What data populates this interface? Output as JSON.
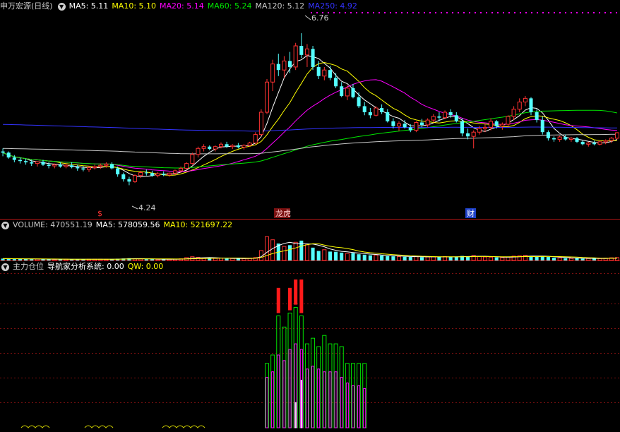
{
  "stock": {
    "name": "申万宏源",
    "period": "(日线)"
  },
  "colors": {
    "bg": "#000000",
    "up": "#ff3232",
    "down": "#54ffff",
    "ma5": "#ffffff",
    "ma10": "#ffff00",
    "ma20": "#ff00ff",
    "ma60": "#00e600",
    "ma120": "#c8c8c8",
    "ma250": "#3333ff",
    "axis": "#b01515",
    "panel": "#ff3c3c"
  },
  "price_legend": [
    {
      "label": "MA5: 5.11",
      "color": "#ffffff"
    },
    {
      "label": "MA10: 5.10",
      "color": "#ffff00"
    },
    {
      "label": "MA20: 5.14",
      "color": "#ff00ff"
    },
    {
      "label": "MA60: 5.24",
      "color": "#00e600"
    },
    {
      "label": "MA120: 5.12",
      "color": "#c8c8c8"
    },
    {
      "label": "MA250: 4.92",
      "color": "#3333ff"
    }
  ],
  "volume_legend": {
    "title": "VOLUME: 470551.19",
    "items": [
      {
        "label": "MA5: 578059.56",
        "color": "#ffffff"
      },
      {
        "label": "MA10: 521697.22",
        "color": "#ffff00"
      }
    ]
  },
  "indicator_legend": {
    "title": "主力仓位",
    "items": [
      {
        "label": "导航家分析系统: 0.00",
        "color": "#ffffff"
      },
      {
        "label": "QW: 0.00",
        "color": "#ffff00"
      }
    ]
  },
  "markers": {
    "high": "6.76",
    "low": "4.24",
    "event1": "$",
    "event2": "龙虎",
    "event3": "财"
  },
  "chart_data": {
    "type": "candlestick",
    "ylim": [
      3.8,
      7.1
    ],
    "ohlc": [
      [
        4.8,
        4.85,
        4.72,
        4.78
      ],
      [
        4.78,
        4.8,
        4.68,
        4.7
      ],
      [
        4.7,
        4.74,
        4.62,
        4.66
      ],
      [
        4.66,
        4.7,
        4.6,
        4.64
      ],
      [
        4.64,
        4.68,
        4.58,
        4.62
      ],
      [
        4.62,
        4.66,
        4.56,
        4.6
      ],
      [
        4.6,
        4.64,
        4.55,
        4.63
      ],
      [
        4.63,
        4.66,
        4.56,
        4.58
      ],
      [
        4.58,
        4.62,
        4.52,
        4.56
      ],
      [
        4.56,
        4.6,
        4.52,
        4.58
      ],
      [
        4.58,
        4.62,
        4.53,
        4.55
      ],
      [
        4.55,
        4.6,
        4.52,
        4.57
      ],
      [
        4.57,
        4.62,
        4.52,
        4.54
      ],
      [
        4.54,
        4.58,
        4.48,
        4.52
      ],
      [
        4.52,
        4.56,
        4.47,
        4.5
      ],
      [
        4.5,
        4.56,
        4.46,
        4.53
      ],
      [
        4.53,
        4.58,
        4.5,
        4.55
      ],
      [
        4.55,
        4.6,
        4.51,
        4.57
      ],
      [
        4.57,
        4.62,
        4.53,
        4.59
      ],
      [
        4.59,
        4.62,
        4.5,
        4.52
      ],
      [
        4.52,
        4.55,
        4.38,
        4.42
      ],
      [
        4.42,
        4.45,
        4.3,
        4.34
      ],
      [
        4.34,
        4.38,
        4.24,
        4.3
      ],
      [
        4.3,
        4.42,
        4.28,
        4.4
      ],
      [
        4.4,
        4.48,
        4.36,
        4.45
      ],
      [
        4.45,
        4.5,
        4.4,
        4.44
      ],
      [
        4.44,
        4.48,
        4.38,
        4.4
      ],
      [
        4.4,
        4.46,
        4.37,
        4.43
      ],
      [
        4.43,
        4.47,
        4.39,
        4.41
      ],
      [
        4.41,
        4.45,
        4.38,
        4.44
      ],
      [
        4.44,
        4.5,
        4.41,
        4.48
      ],
      [
        4.48,
        4.55,
        4.45,
        4.52
      ],
      [
        4.52,
        4.62,
        4.5,
        4.6
      ],
      [
        4.6,
        4.78,
        4.58,
        4.75
      ],
      [
        4.75,
        4.88,
        4.7,
        4.85
      ],
      [
        4.85,
        4.92,
        4.8,
        4.88
      ],
      [
        4.88,
        4.9,
        4.82,
        4.84
      ],
      [
        4.84,
        4.9,
        4.8,
        4.88
      ],
      [
        4.88,
        4.95,
        4.85,
        4.92
      ],
      [
        4.92,
        4.96,
        4.86,
        4.88
      ],
      [
        4.88,
        4.92,
        4.84,
        4.9
      ],
      [
        4.9,
        4.94,
        4.85,
        4.87
      ],
      [
        4.87,
        4.92,
        4.83,
        4.9
      ],
      [
        4.9,
        4.96,
        4.88,
        4.94
      ],
      [
        4.94,
        5.12,
        4.92,
        5.08
      ],
      [
        5.08,
        5.5,
        5.05,
        5.45
      ],
      [
        5.45,
        6.0,
        5.42,
        5.95
      ],
      [
        5.95,
        6.32,
        5.8,
        6.25
      ],
      [
        6.25,
        6.42,
        6.05,
        6.15
      ],
      [
        6.15,
        6.38,
        6.02,
        6.3
      ],
      [
        6.3,
        6.45,
        6.1,
        6.2
      ],
      [
        6.2,
        6.6,
        6.15,
        6.55
      ],
      [
        6.55,
        6.76,
        6.35,
        6.4
      ],
      [
        6.4,
        6.58,
        6.2,
        6.5
      ],
      [
        6.5,
        6.55,
        6.15,
        6.2
      ],
      [
        6.2,
        6.3,
        6.0,
        6.05
      ],
      [
        6.05,
        6.2,
        5.98,
        6.15
      ],
      [
        6.15,
        6.22,
        5.98,
        6.02
      ],
      [
        6.02,
        6.1,
        5.85,
        5.88
      ],
      [
        5.88,
        5.95,
        5.7,
        5.72
      ],
      [
        5.72,
        5.9,
        5.65,
        5.85
      ],
      [
        5.85,
        5.92,
        5.68,
        5.7
      ],
      [
        5.7,
        5.78,
        5.52,
        5.55
      ],
      [
        5.55,
        5.62,
        5.4,
        5.45
      ],
      [
        5.45,
        5.52,
        5.35,
        5.4
      ],
      [
        5.4,
        5.55,
        5.38,
        5.52
      ],
      [
        5.52,
        5.58,
        5.42,
        5.45
      ],
      [
        5.45,
        5.5,
        5.28,
        5.3
      ],
      [
        5.3,
        5.35,
        5.18,
        5.22
      ],
      [
        5.22,
        5.3,
        5.14,
        5.26
      ],
      [
        5.26,
        5.32,
        5.18,
        5.2
      ],
      [
        5.2,
        5.25,
        5.12,
        5.15
      ],
      [
        5.15,
        5.3,
        5.12,
        5.28
      ],
      [
        5.28,
        5.34,
        5.2,
        5.24
      ],
      [
        5.24,
        5.35,
        5.2,
        5.32
      ],
      [
        5.32,
        5.42,
        5.28,
        5.38
      ],
      [
        5.38,
        5.45,
        5.3,
        5.36
      ],
      [
        5.36,
        5.48,
        5.34,
        5.45
      ],
      [
        5.45,
        5.5,
        5.36,
        5.4
      ],
      [
        5.4,
        5.45,
        5.28,
        5.3
      ],
      [
        5.3,
        5.35,
        5.05,
        5.1
      ],
      [
        5.1,
        5.18,
        5.0,
        5.05
      ],
      [
        5.05,
        5.15,
        4.85,
        5.12
      ],
      [
        5.12,
        5.22,
        5.08,
        5.18
      ],
      [
        5.18,
        5.25,
        5.12,
        5.2
      ],
      [
        5.2,
        5.35,
        5.15,
        5.3
      ],
      [
        5.3,
        5.32,
        5.18,
        5.22
      ],
      [
        5.22,
        5.28,
        5.16,
        5.25
      ],
      [
        5.25,
        5.4,
        5.2,
        5.38
      ],
      [
        5.38,
        5.55,
        5.32,
        5.5
      ],
      [
        5.5,
        5.68,
        5.45,
        5.62
      ],
      [
        5.62,
        5.72,
        5.55,
        5.68
      ],
      [
        5.68,
        5.7,
        5.4,
        5.45
      ],
      [
        5.45,
        5.5,
        5.28,
        5.32
      ],
      [
        5.32,
        5.38,
        5.08,
        5.12
      ],
      [
        5.12,
        5.15,
        4.98,
        5.02
      ],
      [
        5.02,
        5.05,
        4.96,
        5.0
      ],
      [
        5.0,
        5.06,
        4.96,
        5.04
      ],
      [
        5.04,
        5.08,
        4.98,
        5.0
      ],
      [
        5.0,
        5.04,
        4.96,
        5.02
      ],
      [
        5.02,
        5.04,
        4.94,
        4.96
      ],
      [
        4.96,
        4.98,
        4.9,
        4.92
      ],
      [
        4.92,
        4.96,
        4.88,
        4.94
      ],
      [
        4.94,
        4.98,
        4.9,
        4.92
      ],
      [
        4.92,
        4.98,
        4.9,
        4.96
      ],
      [
        4.96,
        5.0,
        4.92,
        4.98
      ],
      [
        4.98,
        5.04,
        4.94,
        5.02
      ],
      [
        5.02,
        5.12,
        5.0,
        5.11
      ]
    ],
    "volume_ylim": [
      0,
      1400000
    ],
    "volume": [
      90000,
      85000,
      80000,
      70000,
      75000,
      60000,
      65000,
      70000,
      58000,
      55000,
      60000,
      62000,
      55000,
      60000,
      52000,
      58000,
      60000,
      62000,
      55000,
      70000,
      85000,
      95000,
      110000,
      80000,
      70000,
      60000,
      58000,
      55000,
      62000,
      60000,
      68000,
      80000,
      140000,
      180000,
      150000,
      120000,
      110000,
      100000,
      120000,
      90000,
      95000,
      88000,
      92000,
      110000,
      140000,
      480000,
      1150000,
      1000000,
      820000,
      680000,
      740000,
      880000,
      960000,
      760000,
      620000,
      460000,
      520000,
      430000,
      420000,
      380000,
      340000,
      360000,
      300000,
      280000,
      250000,
      260000,
      240000,
      210000,
      200000,
      190000,
      180000,
      170000,
      190000,
      160000,
      170000,
      180000,
      170000,
      190000,
      160000,
      180000,
      220000,
      200000,
      240000,
      190000,
      170000,
      160000,
      150000,
      140000,
      170000,
      210000,
      230000,
      250000,
      200000,
      180000,
      220000,
      170000,
      130000,
      120000,
      110000,
      100000,
      120000,
      90000,
      95000,
      100000,
      90000,
      110000,
      130000,
      140000
    ],
    "indicator": {
      "green": [
        0,
        0,
        0,
        0,
        0,
        0,
        0,
        0,
        0,
        0,
        0,
        0,
        0,
        0,
        0,
        0,
        0,
        0,
        0,
        0,
        0,
        0,
        0,
        0,
        0,
        0,
        0,
        0,
        0,
        0,
        0,
        0,
        0,
        0,
        0,
        0,
        0,
        0,
        0,
        0,
        0,
        0,
        0,
        0,
        0,
        0,
        46,
        52,
        80,
        72,
        82,
        86,
        80,
        60,
        64,
        58,
        66,
        60,
        60,
        58,
        46,
        46,
        46,
        46,
        0,
        0,
        0,
        0,
        0,
        0,
        0,
        0,
        0,
        0,
        0,
        0,
        0,
        0,
        0,
        0,
        0,
        0,
        0,
        0,
        0,
        0,
        0,
        0,
        0,
        0,
        0,
        0,
        0,
        0,
        0,
        0,
        0,
        0,
        0,
        0,
        0,
        0,
        0,
        0,
        0,
        0,
        0,
        0
      ],
      "magenta": [
        0,
        0,
        0,
        0,
        0,
        0,
        0,
        0,
        0,
        0,
        0,
        0,
        0,
        0,
        0,
        0,
        0,
        0,
        0,
        0,
        0,
        0,
        0,
        0,
        0,
        0,
        0,
        0,
        0,
        0,
        0,
        0,
        0,
        0,
        0,
        0,
        0,
        0,
        0,
        0,
        0,
        0,
        0,
        0,
        0,
        0,
        36,
        40,
        52,
        48,
        56,
        60,
        56,
        42,
        44,
        42,
        40,
        40,
        40,
        36,
        32,
        30,
        30,
        28,
        0,
        0,
        0,
        0,
        0,
        0,
        0,
        0,
        0,
        0,
        0,
        0,
        0,
        0,
        0,
        0,
        0,
        0,
        0,
        0,
        0,
        0,
        0,
        0,
        0,
        0,
        0,
        0,
        0,
        0,
        0,
        0,
        0,
        0,
        0,
        0,
        0,
        0,
        0,
        0,
        0,
        0,
        0,
        0
      ],
      "white": [
        0,
        0,
        0,
        0,
        0,
        0,
        0,
        0,
        0,
        0,
        0,
        0,
        0,
        0,
        0,
        0,
        0,
        0,
        0,
        0,
        0,
        0,
        0,
        0,
        0,
        0,
        0,
        0,
        0,
        0,
        0,
        0,
        0,
        0,
        0,
        0,
        0,
        0,
        0,
        0,
        0,
        0,
        0,
        0,
        0,
        0,
        0,
        0,
        0,
        0,
        0,
        18,
        34,
        0,
        0,
        0,
        0,
        0,
        0,
        0,
        0,
        0,
        0,
        0,
        0,
        0,
        0,
        0,
        0,
        0,
        0,
        0,
        0,
        0,
        0,
        0,
        0,
        0,
        0,
        0,
        0,
        0,
        0,
        0,
        0,
        0,
        0,
        0,
        0,
        0,
        0,
        0,
        0,
        0,
        0,
        0,
        0,
        0,
        0,
        0,
        0,
        0,
        0,
        0,
        0,
        0,
        0,
        0,
        0,
        0,
        0,
        0
      ],
      "red": [
        0,
        0,
        0,
        0,
        0,
        0,
        0,
        0,
        0,
        0,
        0,
        0,
        0,
        0,
        0,
        0,
        0,
        0,
        0,
        0,
        0,
        0,
        0,
        0,
        0,
        0,
        0,
        0,
        0,
        0,
        0,
        0,
        0,
        0,
        0,
        0,
        0,
        0,
        0,
        0,
        0,
        0,
        0,
        0,
        0,
        0,
        0,
        0,
        100,
        0,
        100,
        106,
        106,
        0,
        0,
        0,
        0,
        0,
        0,
        0,
        0,
        0,
        0,
        0,
        0,
        0,
        0,
        0,
        0,
        0,
        0,
        0,
        0,
        0,
        0,
        0,
        0,
        0,
        0,
        0,
        0,
        0,
        0,
        0,
        0,
        0,
        0,
        0,
        0,
        0,
        0,
        0,
        0,
        0,
        0,
        0,
        0,
        0,
        0,
        0,
        0,
        0,
        0,
        0,
        0,
        0,
        0,
        0,
        0,
        0,
        0,
        0
      ],
      "ylim": [
        0,
        110
      ]
    }
  }
}
